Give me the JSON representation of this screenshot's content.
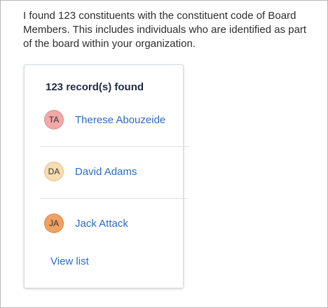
{
  "message": {
    "text": "I found 123 constituents with the constituent code of Board Members. This includes individuals who are identified as part of the board within your organization."
  },
  "results_card": {
    "count_label": "123 record(s) found",
    "records": [
      {
        "initials": "TA",
        "name": "Therese Abouzeide",
        "avatar_color": "#f2a8a8"
      },
      {
        "initials": "DA",
        "name": "David Adams",
        "avatar_color": "#f8ddb0"
      },
      {
        "initials": "JA",
        "name": "Jack Attack",
        "avatar_color": "#f0a060"
      }
    ],
    "view_list_label": "View list"
  },
  "colors": {
    "link": "#2b6cc4",
    "title": "#1f2a44",
    "body_text": "#2d2d2d"
  }
}
